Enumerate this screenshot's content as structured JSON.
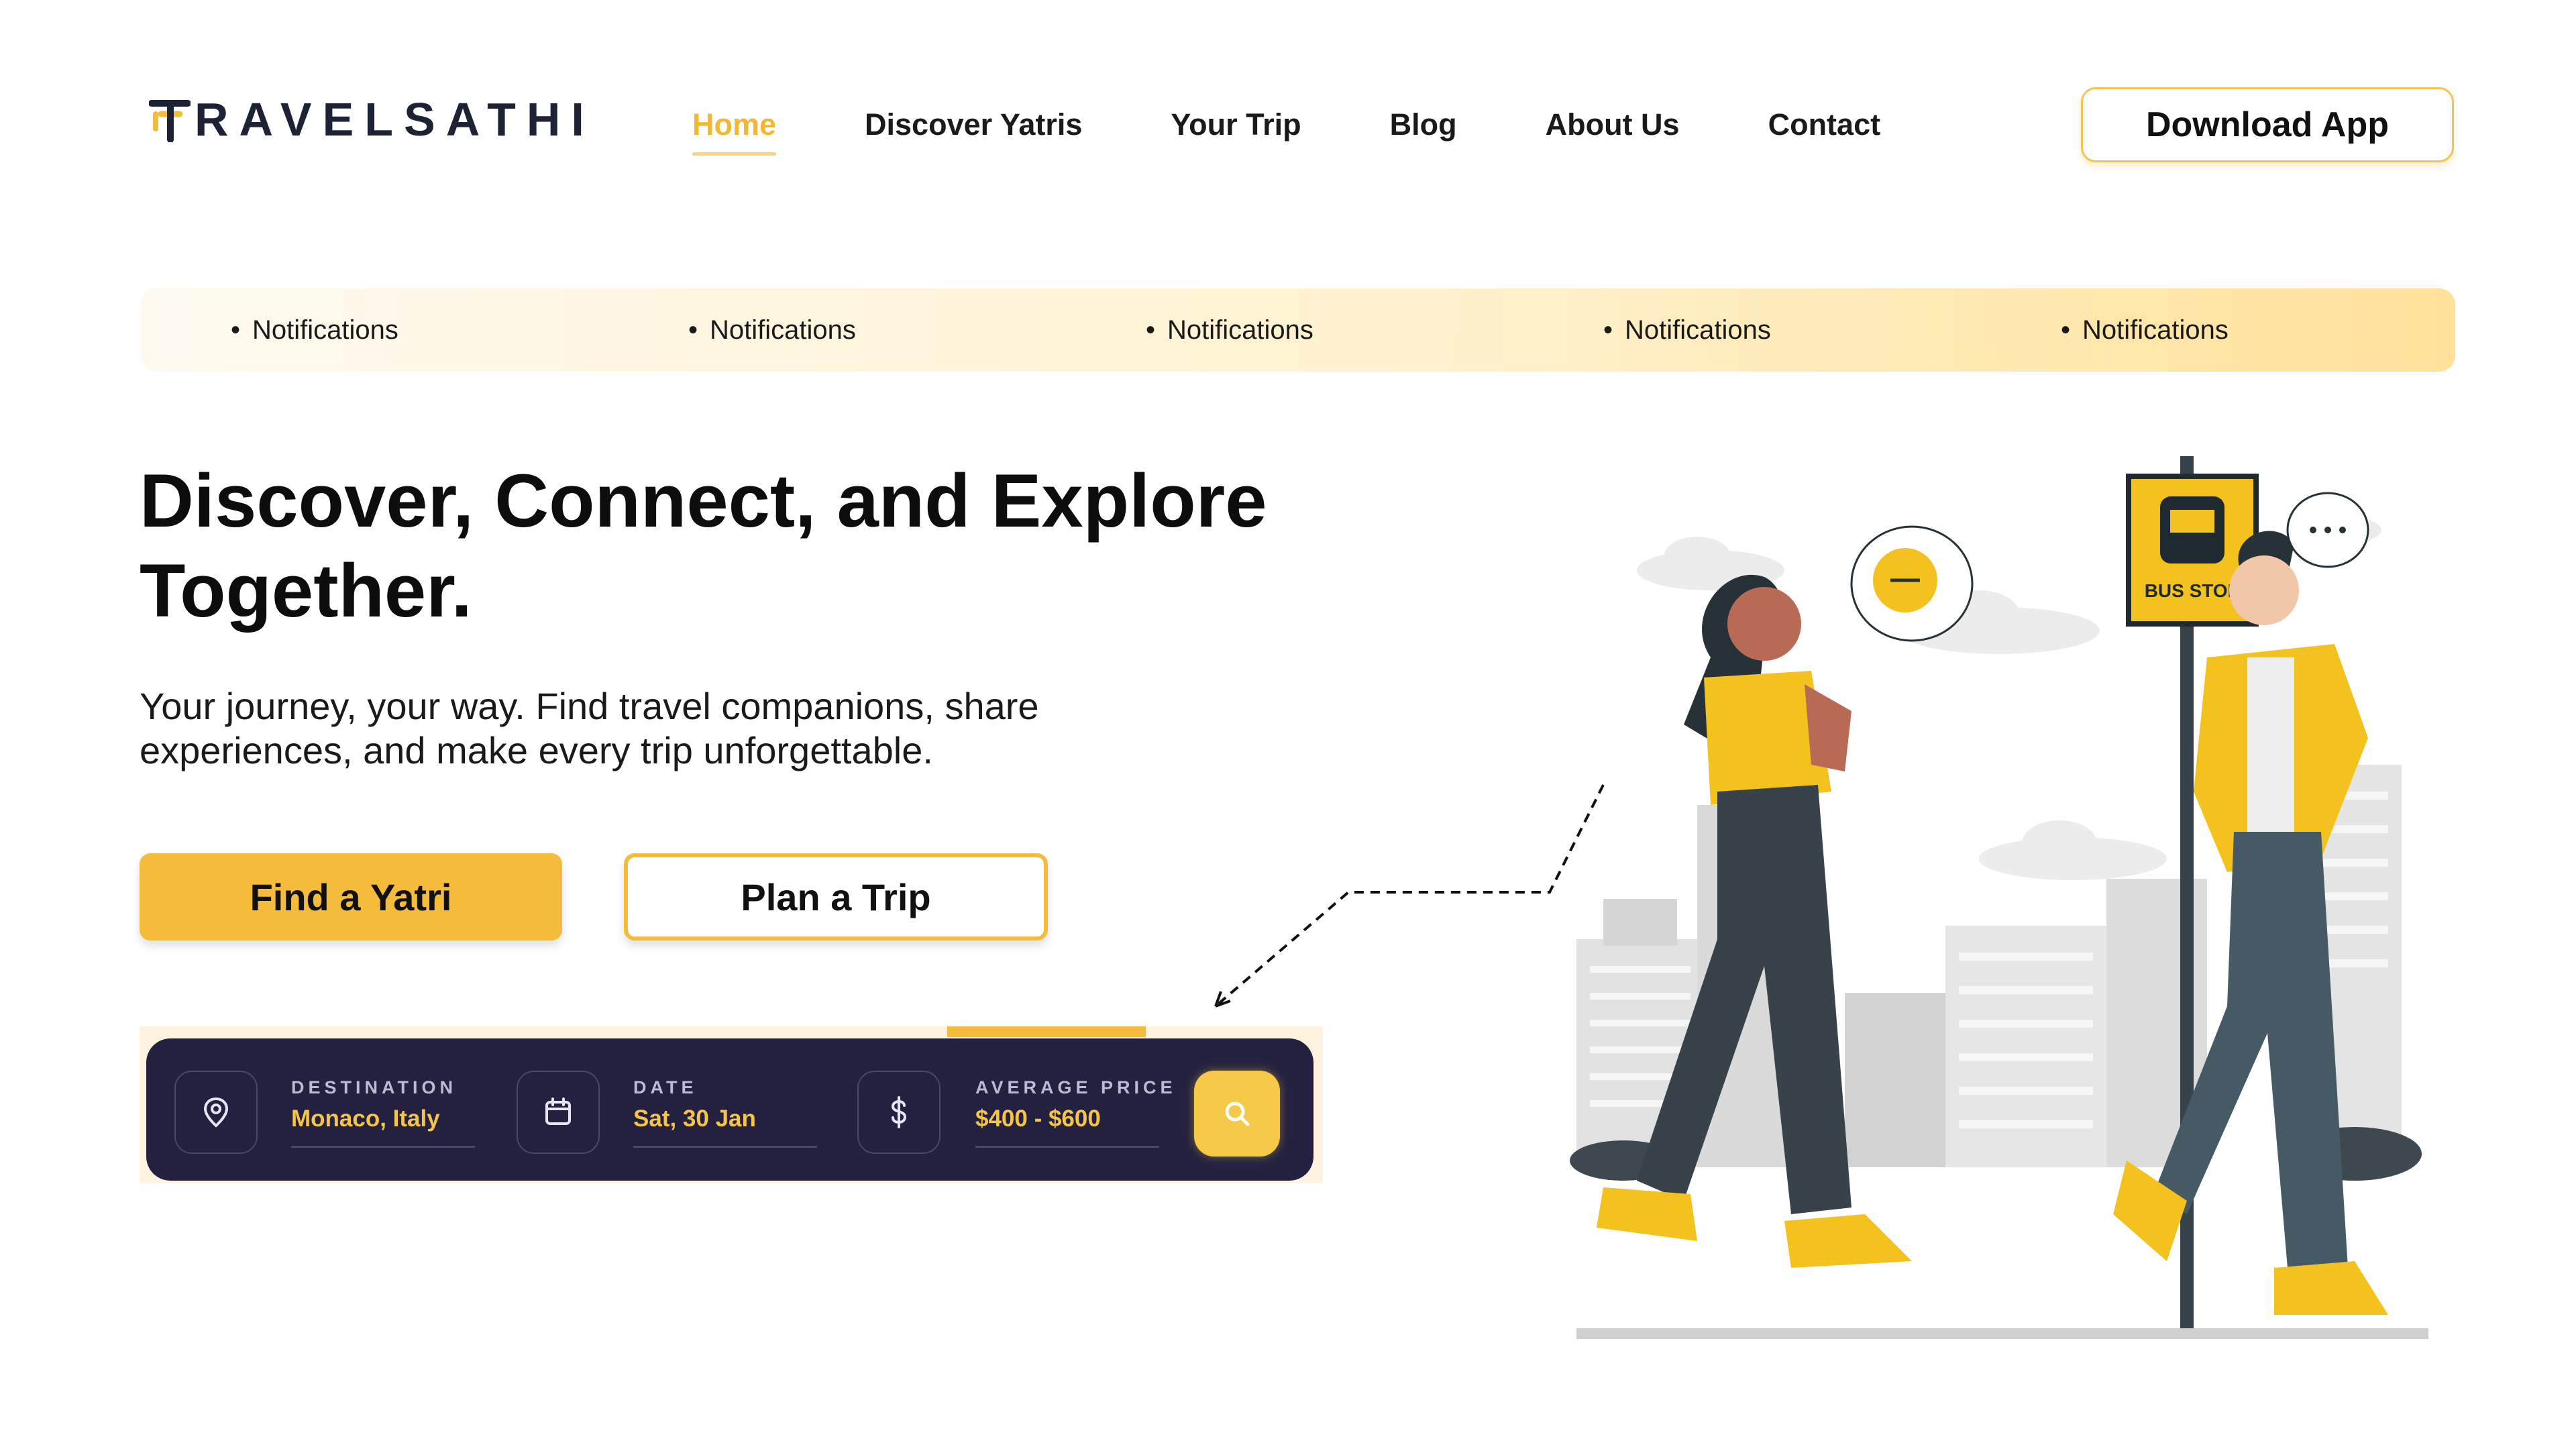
{
  "brand": {
    "name": "RAVELSATHI",
    "colors": {
      "accent": "#f4bc3a",
      "dark": "#1e2235",
      "panel": "#23213f"
    }
  },
  "nav": {
    "items": [
      {
        "label": "Home",
        "active": true
      },
      {
        "label": "Discover Yatris",
        "active": false
      },
      {
        "label": "Your Trip",
        "active": false
      },
      {
        "label": "Blog",
        "active": false
      },
      {
        "label": "About Us",
        "active": false
      },
      {
        "label": "Contact",
        "active": false
      }
    ],
    "download_label": "Download App"
  },
  "notifications": [
    "Notifications",
    "Notifications",
    "Notifications",
    "Notifications",
    "Notifications"
  ],
  "hero": {
    "title_line1": "Discover, Connect, and Explore",
    "title_line2": "Together.",
    "subtitle_line1": "Your journey, your way. Find travel companions, share",
    "subtitle_line2": "experiences, and make every trip unforgettable.",
    "primary_button": "Find a Yatri",
    "secondary_button": "Plan a Trip"
  },
  "search": {
    "destination": {
      "label": "DESTINATION",
      "value": "Monaco, Italy",
      "icon": "location-pin-icon"
    },
    "date": {
      "label": "DATE",
      "value": "Sat, 30 Jan",
      "icon": "calendar-icon"
    },
    "price": {
      "label": "AVERAGE PRICE",
      "value": "$400 - $600",
      "icon": "dollar-icon"
    },
    "search_icon": "search-icon"
  },
  "illustration": {
    "bus_sign": "BUS STOP"
  }
}
